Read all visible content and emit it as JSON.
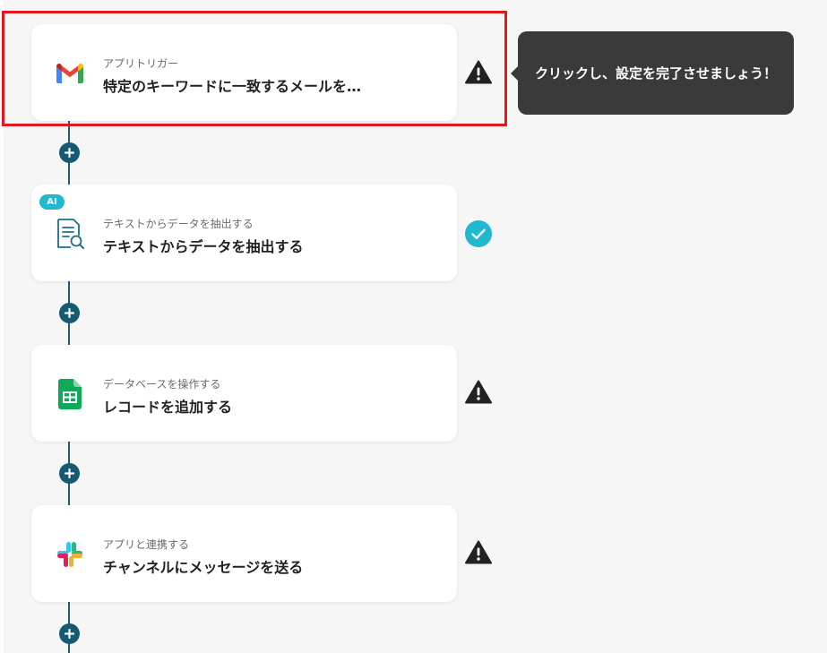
{
  "tooltip": {
    "text": "クリックし、設定を完了させましょう！"
  },
  "steps": [
    {
      "subtitle": "アプリトリガー",
      "title": "特定のキーワードに一致するメールを…",
      "icon": "gmail-icon",
      "status": "warning"
    },
    {
      "badge": "AI",
      "subtitle": "テキストからデータを抽出する",
      "title": "テキストからデータを抽出する",
      "icon": "document-search-icon",
      "status": "complete"
    },
    {
      "subtitle": "データベースを操作する",
      "title": "レコードを追加する",
      "icon": "google-sheets-icon",
      "status": "warning"
    },
    {
      "subtitle": "アプリと連携する",
      "title": "チャンネルにメッセージを送る",
      "icon": "slack-icon",
      "status": "warning"
    }
  ],
  "colors": {
    "connector": "#155a70",
    "highlight": "#e0191e",
    "check": "#22b8cf",
    "tooltip_bg": "#3a3a3a"
  }
}
